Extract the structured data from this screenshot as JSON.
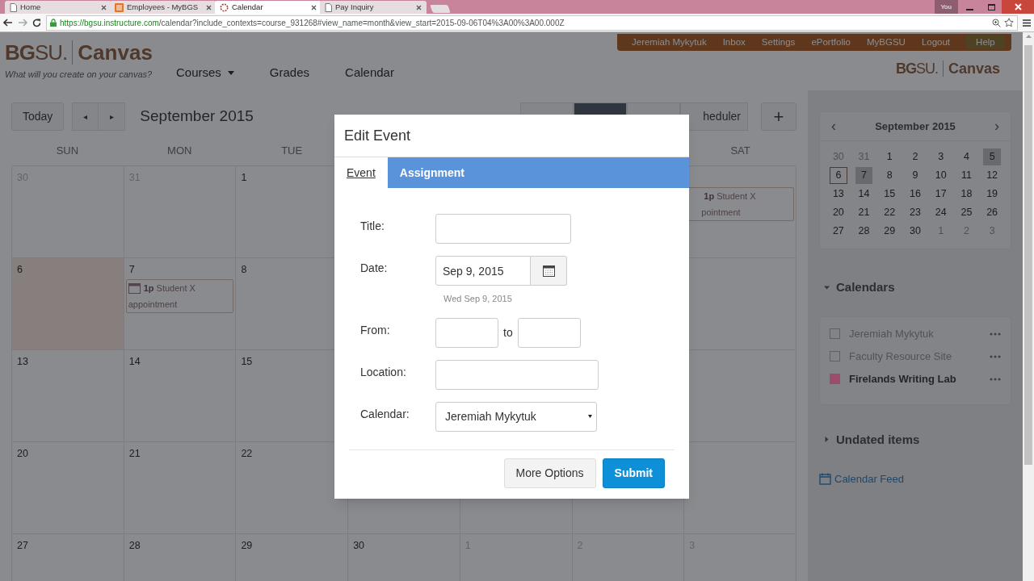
{
  "browser": {
    "tabs": [
      {
        "title": "Home",
        "kind": "page",
        "selected": false
      },
      {
        "title": "Employees - MyBGS",
        "kind": "site",
        "selected": false
      },
      {
        "title": "Calendar",
        "kind": "loading",
        "selected": true
      },
      {
        "title": "Pay Inquiry",
        "kind": "page",
        "selected": false
      }
    ],
    "profile": "You",
    "url_host": "https://bgsu.instructure.com",
    "url_path": "/calendar?include_contexts=course_931268#view_name=month&view_start=2015-09-06T04%3A00%3A00.000Z"
  },
  "header": {
    "logo_mark": "**BG**SU.",
    "logo_name": "Canvas",
    "tagline": "What will you create on your canvas?",
    "nav": [
      {
        "label": "Courses",
        "menu": true
      },
      {
        "label": "Grades",
        "menu": false
      },
      {
        "label": "Calendar",
        "menu": false
      }
    ],
    "user_menu": [
      "Jeremiah Mykytuk",
      "Inbox",
      "Settings",
      "ePortfolio",
      "MyBGSU",
      "Logout",
      "Help"
    ],
    "corner_logo_mark": "**BG**SU.",
    "corner_logo_name": "Canvas"
  },
  "toolbar": {
    "today": "Today",
    "prev": "◂",
    "next": "▸",
    "title": "September 2015",
    "views": [
      {
        "selected": false
      },
      {
        "selected": true
      },
      {
        "selected": false
      },
      {
        "label": "heduler",
        "selected": false
      }
    ],
    "add": "+"
  },
  "weekdays_left": [
    "SUN",
    "MON",
    "TUE"
  ],
  "weekdays_right": [
    "SAT"
  ],
  "weeks": [
    {
      "left": [
        {
          "day": "30",
          "muted": true,
          "today": false
        },
        {
          "day": "31",
          "muted": true,
          "today": false
        },
        {
          "day": "1",
          "muted": false,
          "today": false
        }
      ],
      "right": [
        {
          "events": [
            {
              "icon": false,
              "time": "1p",
              "title": "Student X",
              "continued": "pointment"
            }
          ]
        }
      ]
    },
    {
      "left": [
        {
          "day": "6",
          "muted": false,
          "today": true
        },
        {
          "day": "7",
          "muted": false,
          "today": false,
          "events": [
            {
              "icon": true,
              "time": "1p",
              "title": "Student X",
              "continued": "appointment"
            }
          ]
        },
        {
          "day": "8",
          "muted": false,
          "today": false
        }
      ]
    },
    {
      "left": [
        {
          "day": "13",
          "muted": false,
          "today": false
        },
        {
          "day": "14",
          "muted": false,
          "today": false
        },
        {
          "day": "15",
          "muted": false,
          "today": false
        }
      ]
    },
    {
      "left": [
        {
          "day": "20",
          "muted": false,
          "today": false
        },
        {
          "day": "21",
          "muted": false,
          "today": false
        },
        {
          "day": "22",
          "muted": false,
          "today": false
        }
      ]
    },
    {
      "left": [
        {
          "day": "27",
          "muted": false,
          "today": false
        },
        {
          "day": "28",
          "muted": false,
          "today": false
        },
        {
          "day": "29",
          "muted": false,
          "today": false
        },
        {
          "day": "30",
          "muted": false,
          "today": false
        },
        {
          "day": "1",
          "muted": true,
          "today": false
        },
        {
          "day": "2",
          "muted": true,
          "today": false
        },
        {
          "day": "3",
          "muted": true,
          "today": false
        }
      ]
    }
  ],
  "sidebar": {
    "mini_calendar": {
      "title": "September 2015",
      "prev": "‹",
      "next": "›",
      "weeks": [
        [
          {
            "day": "30",
            "muted": true,
            "today": false,
            "shaded": false
          },
          {
            "day": "31",
            "muted": true,
            "today": false,
            "shaded": false
          },
          {
            "day": "1",
            "muted": false,
            "today": false,
            "shaded": false
          },
          {
            "day": "2",
            "muted": false,
            "today": false,
            "shaded": false
          },
          {
            "day": "3",
            "muted": false,
            "today": false,
            "shaded": false
          },
          {
            "day": "4",
            "muted": false,
            "today": false,
            "shaded": false
          },
          {
            "day": "5",
            "muted": false,
            "today": false,
            "shaded": true
          }
        ],
        [
          {
            "day": "6",
            "muted": false,
            "today": true,
            "shaded": false
          },
          {
            "day": "7",
            "muted": false,
            "today": false,
            "shaded": true
          },
          {
            "day": "8",
            "muted": false,
            "today": false,
            "shaded": false
          },
          {
            "day": "9",
            "muted": false,
            "today": false,
            "shaded": false
          },
          {
            "day": "10",
            "muted": false,
            "today": false,
            "shaded": false
          },
          {
            "day": "11",
            "muted": false,
            "today": false,
            "shaded": false
          },
          {
            "day": "12",
            "muted": false,
            "today": false,
            "shaded": false
          }
        ],
        [
          {
            "day": "13",
            "muted": false,
            "today": false,
            "shaded": false
          },
          {
            "day": "14",
            "muted": false,
            "today": false,
            "shaded": false
          },
          {
            "day": "15",
            "muted": false,
            "today": false,
            "shaded": false
          },
          {
            "day": "16",
            "muted": false,
            "today": false,
            "shaded": false
          },
          {
            "day": "17",
            "muted": false,
            "today": false,
            "shaded": false
          },
          {
            "day": "18",
            "muted": false,
            "today": false,
            "shaded": false
          },
          {
            "day": "19",
            "muted": false,
            "today": false,
            "shaded": false
          }
        ],
        [
          {
            "day": "20",
            "muted": false,
            "today": false,
            "shaded": false
          },
          {
            "day": "21",
            "muted": false,
            "today": false,
            "shaded": false
          },
          {
            "day": "22",
            "muted": false,
            "today": false,
            "shaded": false
          },
          {
            "day": "23",
            "muted": false,
            "today": false,
            "shaded": false
          },
          {
            "day": "24",
            "muted": false,
            "today": false,
            "shaded": false
          },
          {
            "day": "25",
            "muted": false,
            "today": false,
            "shaded": false
          },
          {
            "day": "26",
            "muted": false,
            "today": false,
            "shaded": false
          }
        ],
        [
          {
            "day": "27",
            "muted": false,
            "today": false,
            "shaded": false
          },
          {
            "day": "28",
            "muted": false,
            "today": false,
            "shaded": false
          },
          {
            "day": "29",
            "muted": false,
            "today": false,
            "shaded": false
          },
          {
            "day": "30",
            "muted": false,
            "today": false,
            "shaded": false
          },
          {
            "day": "1",
            "muted": true,
            "today": false,
            "shaded": false
          },
          {
            "day": "2",
            "muted": true,
            "today": false,
            "shaded": false
          },
          {
            "day": "3",
            "muted": true,
            "today": false,
            "shaded": false
          }
        ]
      ]
    },
    "calendars_heading": "Calendars",
    "calendars_expanded": true,
    "calendars": [
      {
        "name": "Jeremiah Mykytuk",
        "checked": false
      },
      {
        "name": "Faculty Resource Site",
        "checked": false
      },
      {
        "name": "Firelands Writing Lab",
        "checked": true,
        "color": "#9b4d6b"
      }
    ],
    "undated_heading": "Undated items",
    "undated_expanded": false,
    "feed": "Calendar Feed"
  },
  "modal": {
    "title": "Edit Event",
    "tabs": [
      {
        "label": "Event",
        "selected": true
      },
      {
        "label": "Assignment",
        "selected": false
      }
    ],
    "fields": [
      {
        "kind": "text",
        "label": "Title:"
      },
      {
        "kind": "date",
        "label": "Date:",
        "value": "Sep 9, 2015",
        "hint": "Wed Sep 9, 2015"
      },
      {
        "kind": "range",
        "label": "From:",
        "separator": "to"
      },
      {
        "kind": "text",
        "label": "Location:"
      },
      {
        "kind": "select",
        "label": "Calendar:",
        "value": "Jeremiah Mykytuk"
      }
    ],
    "buttons": [
      {
        "label": "More Options",
        "primary": false
      },
      {
        "label": "Submit",
        "primary": true
      }
    ]
  }
}
